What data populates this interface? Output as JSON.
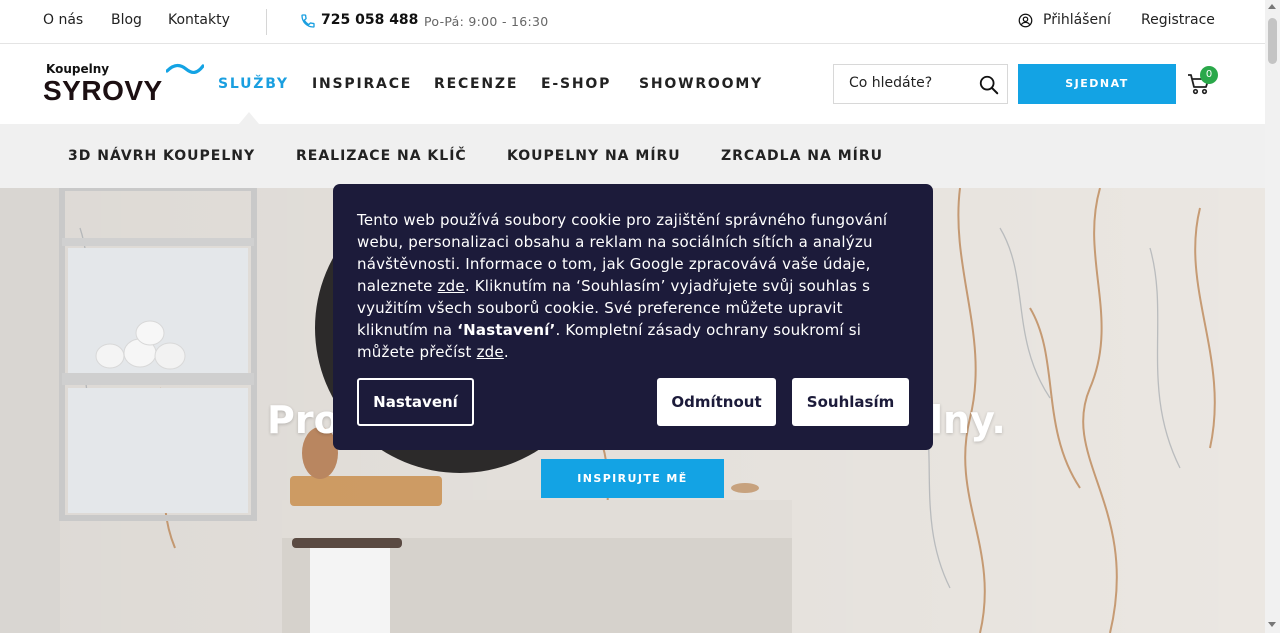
{
  "topbar": {
    "links": [
      "O nás",
      "Blog",
      "Kontakty"
    ],
    "phone": "725 058 488",
    "hours": "Po-Pá: 9:00 - 16:30",
    "login": "Přihlášení",
    "register": "Registrace"
  },
  "header": {
    "logo_small": "Koupelny",
    "logo_big": "SYROVY",
    "nav": [
      "SLUŽBY",
      "INSPIRACE",
      "RECENZE",
      "E-SHOP",
      "SHOWROOMY"
    ],
    "active_nav": "SLUŽBY",
    "search_placeholder": "Co hledáte?",
    "book_button": "SJEDNAT",
    "cart_count": "0",
    "accent_color": "#13a3e4"
  },
  "submenu": [
    "3D NÁVRH KOUPELNY",
    "REALIZACE NA KLÍČ",
    "KOUPELNY NA MÍRU",
    "ZRCADLA NA MÍRU"
  ],
  "hero": {
    "title_left": "Pro",
    "title_right": "lny.",
    "button": "INSPIRUJTE MĚ"
  },
  "cookie": {
    "text_1": "Tento web používá soubory cookie pro zajištění správného fungování webu, personalizaci obsahu a reklam na sociálních sítích a analýzu návštěvnosti. Informace o tom, jak Google zpracovává vaše údaje, naleznete ",
    "link_1": "zde",
    "text_2": ". Kliknutím na ‘Souhlasím’ vyjadřujete svůj souhlas s využitím všech souborů cookie. Své preference můžete upravit kliknutím na ",
    "settings_ref": "‘Nastavení’",
    "text_3": ". Kompletní zásady ochrany soukromí si můžete přečíst ",
    "link_2": "zde",
    "text_4": ".",
    "btn_settings": "Nastavení",
    "btn_reject": "Odmítnout",
    "btn_accept": "Souhlasím",
    "bg_color": "#1c1b3a"
  }
}
